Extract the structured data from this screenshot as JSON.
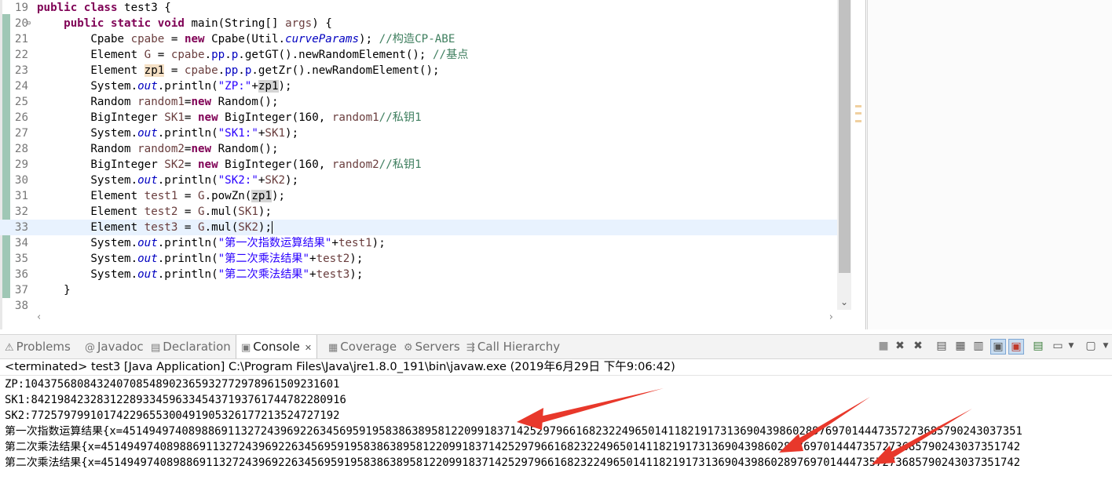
{
  "editor": {
    "lines": [
      {
        "n": "19",
        "current": false,
        "fold": false,
        "segs": [
          [
            "b",
            "public"
          ],
          [
            "",
            " "
          ],
          [
            "b",
            "class"
          ],
          [
            "",
            " test3 {"
          ]
        ]
      },
      {
        "n": "20",
        "current": false,
        "fold": true,
        "segs": [
          [
            "",
            "    "
          ],
          [
            "b",
            "public"
          ],
          [
            "",
            " "
          ],
          [
            "b",
            "static"
          ],
          [
            "",
            " "
          ],
          [
            "b",
            "void"
          ],
          [
            "",
            " main(String[] "
          ],
          [
            "var",
            "args"
          ],
          [
            "",
            ") {"
          ]
        ]
      },
      {
        "n": "21",
        "current": false,
        "fold": false,
        "segs": [
          [
            "",
            "        Cpabe "
          ],
          [
            "var",
            "cpabe"
          ],
          [
            "",
            " = "
          ],
          [
            "b",
            "new"
          ],
          [
            "",
            " Cpabe(Util."
          ],
          [
            "ital",
            "curveParams"
          ],
          [
            "",
            "); "
          ],
          [
            "cmt",
            "//构造CP-ABE"
          ]
        ]
      },
      {
        "n": "22",
        "current": false,
        "fold": false,
        "segs": [
          [
            "",
            "        Element "
          ],
          [
            "var",
            "G"
          ],
          [
            "",
            " = "
          ],
          [
            "var",
            "cpabe"
          ],
          [
            "",
            "."
          ],
          [
            "fld",
            "pp"
          ],
          [
            "",
            "."
          ],
          [
            "fld",
            "p"
          ],
          [
            "",
            ".getGT().newRandomElement(); "
          ],
          [
            "cmt",
            "//基点"
          ]
        ]
      },
      {
        "n": "23",
        "current": false,
        "fold": false,
        "segs": [
          [
            "",
            "        Element "
          ],
          [
            "occw",
            "zp1"
          ],
          [
            "",
            " = "
          ],
          [
            "var",
            "cpabe"
          ],
          [
            "",
            "."
          ],
          [
            "fld",
            "pp"
          ],
          [
            "",
            "."
          ],
          [
            "fld",
            "p"
          ],
          [
            "",
            ".getZr().newRandomElement();"
          ]
        ]
      },
      {
        "n": "24",
        "current": false,
        "fold": false,
        "segs": [
          [
            "",
            "        System."
          ],
          [
            "ital",
            "out"
          ],
          [
            "",
            ".println("
          ],
          [
            "str",
            "\"ZP:\""
          ],
          [
            "",
            "+"
          ],
          [
            "occ",
            "zp1"
          ],
          [
            "",
            ");"
          ]
        ]
      },
      {
        "n": "25",
        "current": false,
        "fold": false,
        "segs": [
          [
            "",
            "        Random "
          ],
          [
            "var",
            "random1"
          ],
          [
            "",
            "="
          ],
          [
            "b",
            "new"
          ],
          [
            "",
            " Random();"
          ]
        ]
      },
      {
        "n": "26",
        "current": false,
        "fold": false,
        "segs": [
          [
            "",
            "        BigInteger "
          ],
          [
            "var",
            "SK1"
          ],
          [
            "",
            "= "
          ],
          [
            "b",
            "new"
          ],
          [
            "",
            " BigInteger(160, "
          ],
          [
            "var",
            "random1"
          ],
          [
            ");"
          ],
          [
            "cmt",
            "//私钥1"
          ]
        ]
      },
      {
        "n": "27",
        "current": false,
        "fold": false,
        "segs": [
          [
            "",
            "        System."
          ],
          [
            "ital",
            "out"
          ],
          [
            "",
            ".println("
          ],
          [
            "str",
            "\"SK1:\""
          ],
          [
            "",
            "+"
          ],
          [
            "var",
            "SK1"
          ],
          [
            "",
            ");"
          ]
        ]
      },
      {
        "n": "28",
        "current": false,
        "fold": false,
        "segs": [
          [
            "",
            "        Random "
          ],
          [
            "var",
            "random2"
          ],
          [
            "",
            "="
          ],
          [
            "b",
            "new"
          ],
          [
            "",
            " Random();"
          ]
        ]
      },
      {
        "n": "29",
        "current": false,
        "fold": false,
        "segs": [
          [
            "",
            "        BigInteger "
          ],
          [
            "var",
            "SK2"
          ],
          [
            "",
            "= "
          ],
          [
            "b",
            "new"
          ],
          [
            "",
            " BigInteger(160, "
          ],
          [
            "var",
            "random2"
          ],
          [
            ");"
          ],
          [
            "cmt",
            "//私钥1"
          ]
        ]
      },
      {
        "n": "30",
        "current": false,
        "fold": false,
        "segs": [
          [
            "",
            "        System."
          ],
          [
            "ital",
            "out"
          ],
          [
            "",
            ".println("
          ],
          [
            "str",
            "\"SK2:\""
          ],
          [
            "",
            "+"
          ],
          [
            "var",
            "SK2"
          ],
          [
            "",
            ");"
          ]
        ]
      },
      {
        "n": "31",
        "current": false,
        "fold": false,
        "segs": [
          [
            "",
            "        Element "
          ],
          [
            "var",
            "test1"
          ],
          [
            "",
            " = "
          ],
          [
            "var",
            "G"
          ],
          [
            "",
            ".powZn("
          ],
          [
            "occ",
            "zp1"
          ],
          [
            "",
            ");"
          ]
        ]
      },
      {
        "n": "32",
        "current": false,
        "fold": false,
        "segs": [
          [
            "",
            "        Element "
          ],
          [
            "var",
            "test2"
          ],
          [
            "",
            " = "
          ],
          [
            "var",
            "G"
          ],
          [
            "",
            ".mul("
          ],
          [
            "var",
            "SK1"
          ],
          [
            "",
            ");"
          ]
        ]
      },
      {
        "n": "33",
        "current": true,
        "fold": false,
        "segs": [
          [
            "",
            "        Element "
          ],
          [
            "var",
            "test3"
          ],
          [
            "",
            " = "
          ],
          [
            "var",
            "G"
          ],
          [
            "",
            ".mul("
          ],
          [
            "var",
            "SK2"
          ],
          [
            "",
            ");"
          ]
        ]
      },
      {
        "n": "34",
        "current": false,
        "fold": false,
        "segs": [
          [
            "",
            "        System."
          ],
          [
            "ital",
            "out"
          ],
          [
            "",
            ".println("
          ],
          [
            "str",
            "\"第一次指数运算结果\""
          ],
          [
            "",
            "+"
          ],
          [
            "var",
            "test1"
          ],
          [
            "",
            ");"
          ]
        ]
      },
      {
        "n": "35",
        "current": false,
        "fold": false,
        "segs": [
          [
            "",
            "        System."
          ],
          [
            "ital",
            "out"
          ],
          [
            "",
            ".println("
          ],
          [
            "str",
            "\"第二次乘法结果\""
          ],
          [
            "",
            "+"
          ],
          [
            "var",
            "test2"
          ],
          [
            "",
            ");"
          ]
        ]
      },
      {
        "n": "36",
        "current": false,
        "fold": false,
        "segs": [
          [
            "",
            "        System."
          ],
          [
            "ital",
            "out"
          ],
          [
            "",
            ".println("
          ],
          [
            "str",
            "\"第二次乘法结果\""
          ],
          [
            "",
            "+"
          ],
          [
            "var",
            "test3"
          ],
          [
            "",
            ");"
          ]
        ]
      },
      {
        "n": "37",
        "current": false,
        "fold": false,
        "segs": [
          [
            "",
            "    }"
          ]
        ]
      },
      {
        "n": "38",
        "current": false,
        "fold": false,
        "segs": []
      }
    ]
  },
  "tabs": [
    {
      "label": "Problems",
      "icon": "problems-icon",
      "glyph": "⚠"
    },
    {
      "label": "Javadoc",
      "icon": "javadoc-icon",
      "glyph": "@"
    },
    {
      "label": "Declaration",
      "icon": "declaration-icon",
      "glyph": "▤"
    },
    {
      "label": "Console",
      "icon": "console-icon",
      "glyph": "▣",
      "close": "✕"
    },
    {
      "label": "Coverage",
      "icon": "coverage-icon",
      "glyph": "▦"
    },
    {
      "label": "Servers",
      "icon": "servers-icon",
      "glyph": "⚙"
    },
    {
      "label": "Call Hierarchy",
      "icon": "call-hierarchy-icon",
      "glyph": "⇶"
    }
  ],
  "console": {
    "header": "<terminated> test3 [Java Application] C:\\Program Files\\Java\\jre1.8.0_191\\bin\\javaw.exe (2019年6月29日 下午9:06:42)",
    "lines": [
      "ZP:1043756808432407085489023659327729789615092316​01",
      "SK1:842198423283122893345963345437193761744782280916",
      "SK2:772579799101742296553004919053261772135247271​92",
      "第一次指数运算结果{x=45149497408988691132724396922634569591958386389581220991837142529796616823224965014118219173136904398602897697014447357273685790243037351",
      "第二次乘法结果{x=45149497408988691132724396922634569591958386389581220991837142529796616823224965014118219173136904398602897697014447357273685790243037351742",
      "第二次乘法结果{x=45149497408988691132724396922634569591958386389581220991837142529796616823224965014118219173136904398602897697014447357273685790243037351742"
    ]
  },
  "colors": {
    "keyword": "#7f0055",
    "string": "#2a00ff",
    "comment": "#3f7f5f",
    "arrow": "#e8382b"
  }
}
